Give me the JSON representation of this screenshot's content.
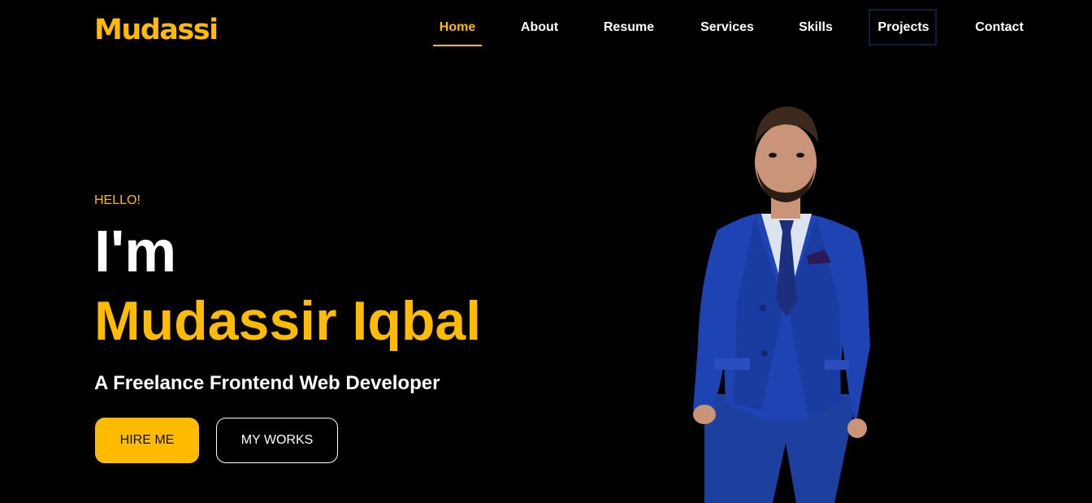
{
  "colors": {
    "accent": "#ffbb00",
    "background": "#000000",
    "text": "#ffffff"
  },
  "brand": {
    "logo_text": "Mudassir."
  },
  "nav": {
    "items": [
      {
        "label": "Home",
        "active": true
      },
      {
        "label": "About"
      },
      {
        "label": "Resume"
      },
      {
        "label": "Services"
      },
      {
        "label": "Skills"
      },
      {
        "label": "Projects",
        "focused": true
      },
      {
        "label": "Contact"
      }
    ]
  },
  "hero": {
    "greeting": "HELLO!",
    "intro": "I'm",
    "name": "Mudassir Iqbal",
    "tagline": "A Freelance Frontend Web Developer",
    "buttons": {
      "hire": "HIRE ME",
      "works": "MY WORKS"
    }
  },
  "portrait": {
    "icon": "person-portrait-icon"
  }
}
